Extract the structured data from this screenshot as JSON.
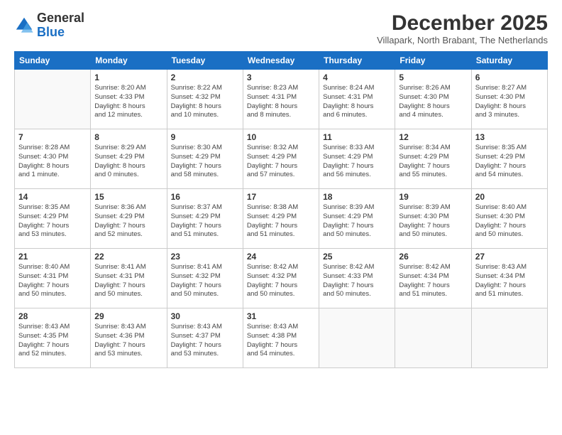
{
  "logo": {
    "general": "General",
    "blue": "Blue"
  },
  "header": {
    "month": "December 2025",
    "location": "Villapark, North Brabant, The Netherlands"
  },
  "weekdays": [
    "Sunday",
    "Monday",
    "Tuesday",
    "Wednesday",
    "Thursday",
    "Friday",
    "Saturday"
  ],
  "weeks": [
    [
      {
        "day": "",
        "info": ""
      },
      {
        "day": "1",
        "info": "Sunrise: 8:20 AM\nSunset: 4:33 PM\nDaylight: 8 hours\nand 12 minutes."
      },
      {
        "day": "2",
        "info": "Sunrise: 8:22 AM\nSunset: 4:32 PM\nDaylight: 8 hours\nand 10 minutes."
      },
      {
        "day": "3",
        "info": "Sunrise: 8:23 AM\nSunset: 4:31 PM\nDaylight: 8 hours\nand 8 minutes."
      },
      {
        "day": "4",
        "info": "Sunrise: 8:24 AM\nSunset: 4:31 PM\nDaylight: 8 hours\nand 6 minutes."
      },
      {
        "day": "5",
        "info": "Sunrise: 8:26 AM\nSunset: 4:30 PM\nDaylight: 8 hours\nand 4 minutes."
      },
      {
        "day": "6",
        "info": "Sunrise: 8:27 AM\nSunset: 4:30 PM\nDaylight: 8 hours\nand 3 minutes."
      }
    ],
    [
      {
        "day": "7",
        "info": "Sunrise: 8:28 AM\nSunset: 4:30 PM\nDaylight: 8 hours\nand 1 minute."
      },
      {
        "day": "8",
        "info": "Sunrise: 8:29 AM\nSunset: 4:29 PM\nDaylight: 8 hours\nand 0 minutes."
      },
      {
        "day": "9",
        "info": "Sunrise: 8:30 AM\nSunset: 4:29 PM\nDaylight: 7 hours\nand 58 minutes."
      },
      {
        "day": "10",
        "info": "Sunrise: 8:32 AM\nSunset: 4:29 PM\nDaylight: 7 hours\nand 57 minutes."
      },
      {
        "day": "11",
        "info": "Sunrise: 8:33 AM\nSunset: 4:29 PM\nDaylight: 7 hours\nand 56 minutes."
      },
      {
        "day": "12",
        "info": "Sunrise: 8:34 AM\nSunset: 4:29 PM\nDaylight: 7 hours\nand 55 minutes."
      },
      {
        "day": "13",
        "info": "Sunrise: 8:35 AM\nSunset: 4:29 PM\nDaylight: 7 hours\nand 54 minutes."
      }
    ],
    [
      {
        "day": "14",
        "info": "Sunrise: 8:35 AM\nSunset: 4:29 PM\nDaylight: 7 hours\nand 53 minutes."
      },
      {
        "day": "15",
        "info": "Sunrise: 8:36 AM\nSunset: 4:29 PM\nDaylight: 7 hours\nand 52 minutes."
      },
      {
        "day": "16",
        "info": "Sunrise: 8:37 AM\nSunset: 4:29 PM\nDaylight: 7 hours\nand 51 minutes."
      },
      {
        "day": "17",
        "info": "Sunrise: 8:38 AM\nSunset: 4:29 PM\nDaylight: 7 hours\nand 51 minutes."
      },
      {
        "day": "18",
        "info": "Sunrise: 8:39 AM\nSunset: 4:29 PM\nDaylight: 7 hours\nand 50 minutes."
      },
      {
        "day": "19",
        "info": "Sunrise: 8:39 AM\nSunset: 4:30 PM\nDaylight: 7 hours\nand 50 minutes."
      },
      {
        "day": "20",
        "info": "Sunrise: 8:40 AM\nSunset: 4:30 PM\nDaylight: 7 hours\nand 50 minutes."
      }
    ],
    [
      {
        "day": "21",
        "info": "Sunrise: 8:40 AM\nSunset: 4:31 PM\nDaylight: 7 hours\nand 50 minutes."
      },
      {
        "day": "22",
        "info": "Sunrise: 8:41 AM\nSunset: 4:31 PM\nDaylight: 7 hours\nand 50 minutes."
      },
      {
        "day": "23",
        "info": "Sunrise: 8:41 AM\nSunset: 4:32 PM\nDaylight: 7 hours\nand 50 minutes."
      },
      {
        "day": "24",
        "info": "Sunrise: 8:42 AM\nSunset: 4:32 PM\nDaylight: 7 hours\nand 50 minutes."
      },
      {
        "day": "25",
        "info": "Sunrise: 8:42 AM\nSunset: 4:33 PM\nDaylight: 7 hours\nand 50 minutes."
      },
      {
        "day": "26",
        "info": "Sunrise: 8:42 AM\nSunset: 4:34 PM\nDaylight: 7 hours\nand 51 minutes."
      },
      {
        "day": "27",
        "info": "Sunrise: 8:43 AM\nSunset: 4:34 PM\nDaylight: 7 hours\nand 51 minutes."
      }
    ],
    [
      {
        "day": "28",
        "info": "Sunrise: 8:43 AM\nSunset: 4:35 PM\nDaylight: 7 hours\nand 52 minutes."
      },
      {
        "day": "29",
        "info": "Sunrise: 8:43 AM\nSunset: 4:36 PM\nDaylight: 7 hours\nand 53 minutes."
      },
      {
        "day": "30",
        "info": "Sunrise: 8:43 AM\nSunset: 4:37 PM\nDaylight: 7 hours\nand 53 minutes."
      },
      {
        "day": "31",
        "info": "Sunrise: 8:43 AM\nSunset: 4:38 PM\nDaylight: 7 hours\nand 54 minutes."
      },
      {
        "day": "",
        "info": ""
      },
      {
        "day": "",
        "info": ""
      },
      {
        "day": "",
        "info": ""
      }
    ]
  ]
}
